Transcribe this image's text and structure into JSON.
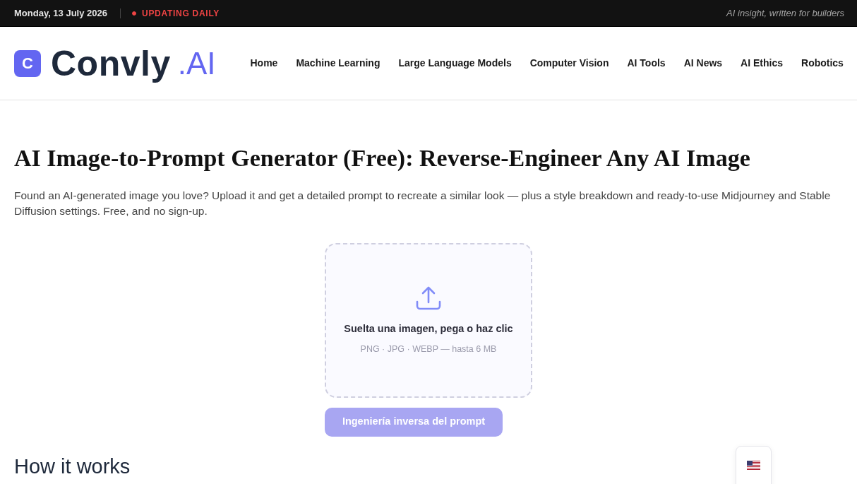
{
  "top_bar": {
    "date": "Monday, 13 July 2026",
    "live_label": "UPDATING DAILY",
    "tagline": "AI insight, written for builders"
  },
  "header": {
    "logo": {
      "mark": "C",
      "name": "Convly",
      "suffix": ".AI"
    },
    "nav": [
      "Home",
      "Machine Learning",
      "Large Language Models",
      "Computer Vision",
      "AI Tools",
      "AI News",
      "AI Ethics",
      "Robotics"
    ]
  },
  "page": {
    "title": "AI Image-to-Prompt Generator (Free): Reverse-Engineer Any AI Image",
    "intro": "Found an AI-generated image you love? Upload it and get a detailed prompt to recreate a similar look — plus a style breakdown and ready-to-use Midjourney and Stable Diffusion settings. Free, and no sign-up.",
    "upload": {
      "title": "Suelta una imagen, pega o haz clic",
      "hint": "PNG · JPG · WEBP — hasta 6 MB"
    },
    "submit_button": {
      "label": "Ingeniería inversa del prompt",
      "disabled": true
    },
    "section_heading": "How it works"
  }
}
